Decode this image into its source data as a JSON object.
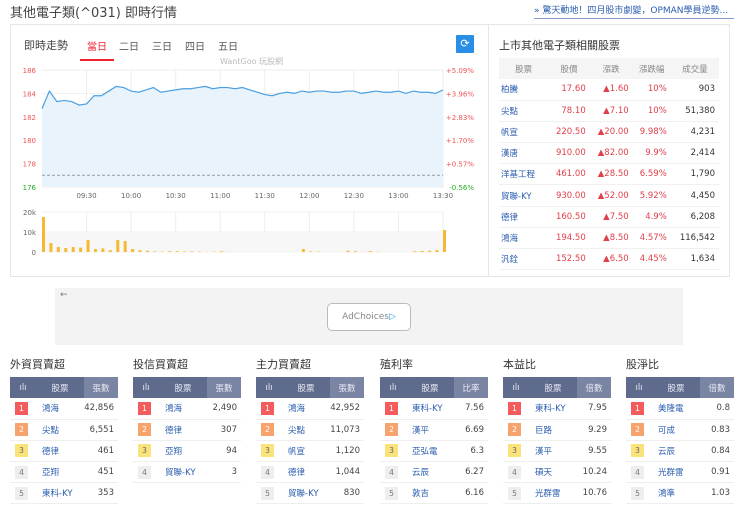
{
  "header": {
    "title": "其他電子類(^031) 即時行情",
    "promo": "» 驚天動地！四月股市劇變，OPMAN學員逆勢..."
  },
  "trend": {
    "label": "即時走勢",
    "tabs": [
      "當日",
      "二日",
      "三日",
      "四日",
      "五日"
    ],
    "active_tab": 0,
    "refresh_icon": "refresh-icon",
    "watermark": "WantGoo 玩股網"
  },
  "chart_data": [
    {
      "type": "area",
      "title": "即時走勢",
      "y_ticks": [
        186,
        184,
        182,
        180,
        178,
        176
      ],
      "y_right_ticks": [
        "+5.09%",
        "+3.96%",
        "+2.83%",
        "+1.70%",
        "+0.57%",
        "-0.56%"
      ],
      "ylim": [
        176,
        186
      ],
      "reference_price": 177,
      "x_ticks": [
        "09:30",
        "10:00",
        "10:30",
        "11:00",
        "11:30",
        "12:00",
        "12:30",
        "13:00",
        "13:30"
      ],
      "x_range_minutes": [
        0,
        270
      ],
      "x_step_minutes": 5,
      "values": [
        182.7,
        184.2,
        183.3,
        183.4,
        183.3,
        183.0,
        183.1,
        183.8,
        183.8,
        184.2,
        184.6,
        184.5,
        184.2,
        184.1,
        184.3,
        184.5,
        184.1,
        184.2,
        184.3,
        184.4,
        184.4,
        184.5,
        184.6,
        184.4,
        184.5,
        184.5,
        184.4,
        184.5,
        184.3,
        184.1,
        183.9,
        183.8,
        184.0,
        184.1,
        184.0,
        184.2,
        184.1,
        184.2,
        184.2,
        184.1,
        184.1,
        184.2,
        184.2,
        184.0,
        184.1,
        184.2,
        184.1,
        184.1,
        184.2,
        184.0,
        184.2,
        184.1,
        184.1,
        184.0,
        184.3
      ]
    },
    {
      "type": "bar",
      "title": "成交量",
      "y_ticks": [
        "20k",
        "10k",
        "0"
      ],
      "ylim": [
        0,
        20000
      ],
      "values": [
        17500,
        4500,
        2500,
        2000,
        2500,
        2200,
        6000,
        1500,
        1800,
        900,
        6000,
        5500,
        1500,
        900,
        600,
        300,
        200,
        400,
        400,
        300,
        300,
        200,
        100,
        200,
        400,
        100,
        0,
        0,
        0,
        0,
        0,
        0,
        0,
        0,
        0,
        1500,
        300,
        200,
        0,
        0,
        0,
        600,
        400,
        100,
        500,
        100,
        0,
        0,
        0,
        0,
        400,
        500,
        600,
        900,
        11000
      ]
    }
  ],
  "related": {
    "title": "上市其他電子類相關股票",
    "columns": [
      "股票",
      "股價",
      "漲跌",
      "漲跌幅",
      "成交量"
    ],
    "rows": [
      [
        "柏騰",
        "17.60",
        "▲1.60",
        "10%",
        "903"
      ],
      [
        "尖點",
        "78.10",
        "▲7.10",
        "10%",
        "51,380"
      ],
      [
        "帆宣",
        "220.50",
        "▲20.00",
        "9.98%",
        "4,231"
      ],
      [
        "漢唐",
        "910.00",
        "▲82.00",
        "9.9%",
        "2,414"
      ],
      [
        "洋基工程",
        "461.00",
        "▲28.50",
        "6.59%",
        "1,790"
      ],
      [
        "貿聯-KY",
        "930.00",
        "▲52.00",
        "5.92%",
        "4,450"
      ],
      [
        "德律",
        "160.50",
        "▲7.50",
        "4.9%",
        "6,208"
      ],
      [
        "鴻海",
        "194.50",
        "▲8.50",
        "4.57%",
        "116,542"
      ],
      [
        "汎銓",
        "152.50",
        "▲6.50",
        "4.45%",
        "1,634"
      ]
    ]
  },
  "ad": {
    "back_icon": "←",
    "label": "AdChoices",
    "icon": "▷"
  },
  "rankings": [
    {
      "title": "外資買賣超",
      "col_stock": "股票",
      "col_value": "張數",
      "rows": [
        [
          "1",
          "鴻海",
          "42,856"
        ],
        [
          "2",
          "尖點",
          "6,551"
        ],
        [
          "3",
          "德律",
          "461"
        ],
        [
          "4",
          "亞翔",
          "451"
        ],
        [
          "5",
          "東科-KY",
          "353"
        ]
      ]
    },
    {
      "title": "投信買賣超",
      "col_stock": "股票",
      "col_value": "張數",
      "rows": [
        [
          "1",
          "鴻海",
          "2,490"
        ],
        [
          "2",
          "德律",
          "307"
        ],
        [
          "3",
          "亞翔",
          "94"
        ],
        [
          "4",
          "貿聯-KY",
          "3"
        ]
      ]
    },
    {
      "title": "主力買賣超",
      "col_stock": "股票",
      "col_value": "張數",
      "rows": [
        [
          "1",
          "鴻海",
          "42,952"
        ],
        [
          "2",
          "尖點",
          "11,073"
        ],
        [
          "3",
          "帆宣",
          "1,120"
        ],
        [
          "4",
          "德律",
          "1,044"
        ],
        [
          "5",
          "貿聯-KY",
          "830"
        ]
      ]
    },
    {
      "title": "殖利率",
      "col_stock": "股票",
      "col_value": "比率",
      "rows": [
        [
          "1",
          "東科-KY",
          "7.56"
        ],
        [
          "2",
          "漢平",
          "6.69"
        ],
        [
          "3",
          "亞弘電",
          "6.3"
        ],
        [
          "4",
          "云辰",
          "6.27"
        ],
        [
          "5",
          "敦吉",
          "6.16"
        ]
      ]
    },
    {
      "title": "本益比",
      "col_stock": "股票",
      "col_value": "倍數",
      "rows": [
        [
          "1",
          "東科-KY",
          "7.95"
        ],
        [
          "2",
          "巨路",
          "9.29"
        ],
        [
          "3",
          "漢平",
          "9.55"
        ],
        [
          "4",
          "碩天",
          "10.24"
        ],
        [
          "5",
          "光群雷",
          "10.76"
        ]
      ]
    },
    {
      "title": "股淨比",
      "col_stock": "股票",
      "col_value": "倍數",
      "rows": [
        [
          "1",
          "美隆電",
          "0.8"
        ],
        [
          "2",
          "可成",
          "0.83"
        ],
        [
          "3",
          "云辰",
          "0.84"
        ],
        [
          "4",
          "光群雷",
          "0.91"
        ],
        [
          "5",
          "鴻準",
          "1.03"
        ]
      ]
    }
  ]
}
